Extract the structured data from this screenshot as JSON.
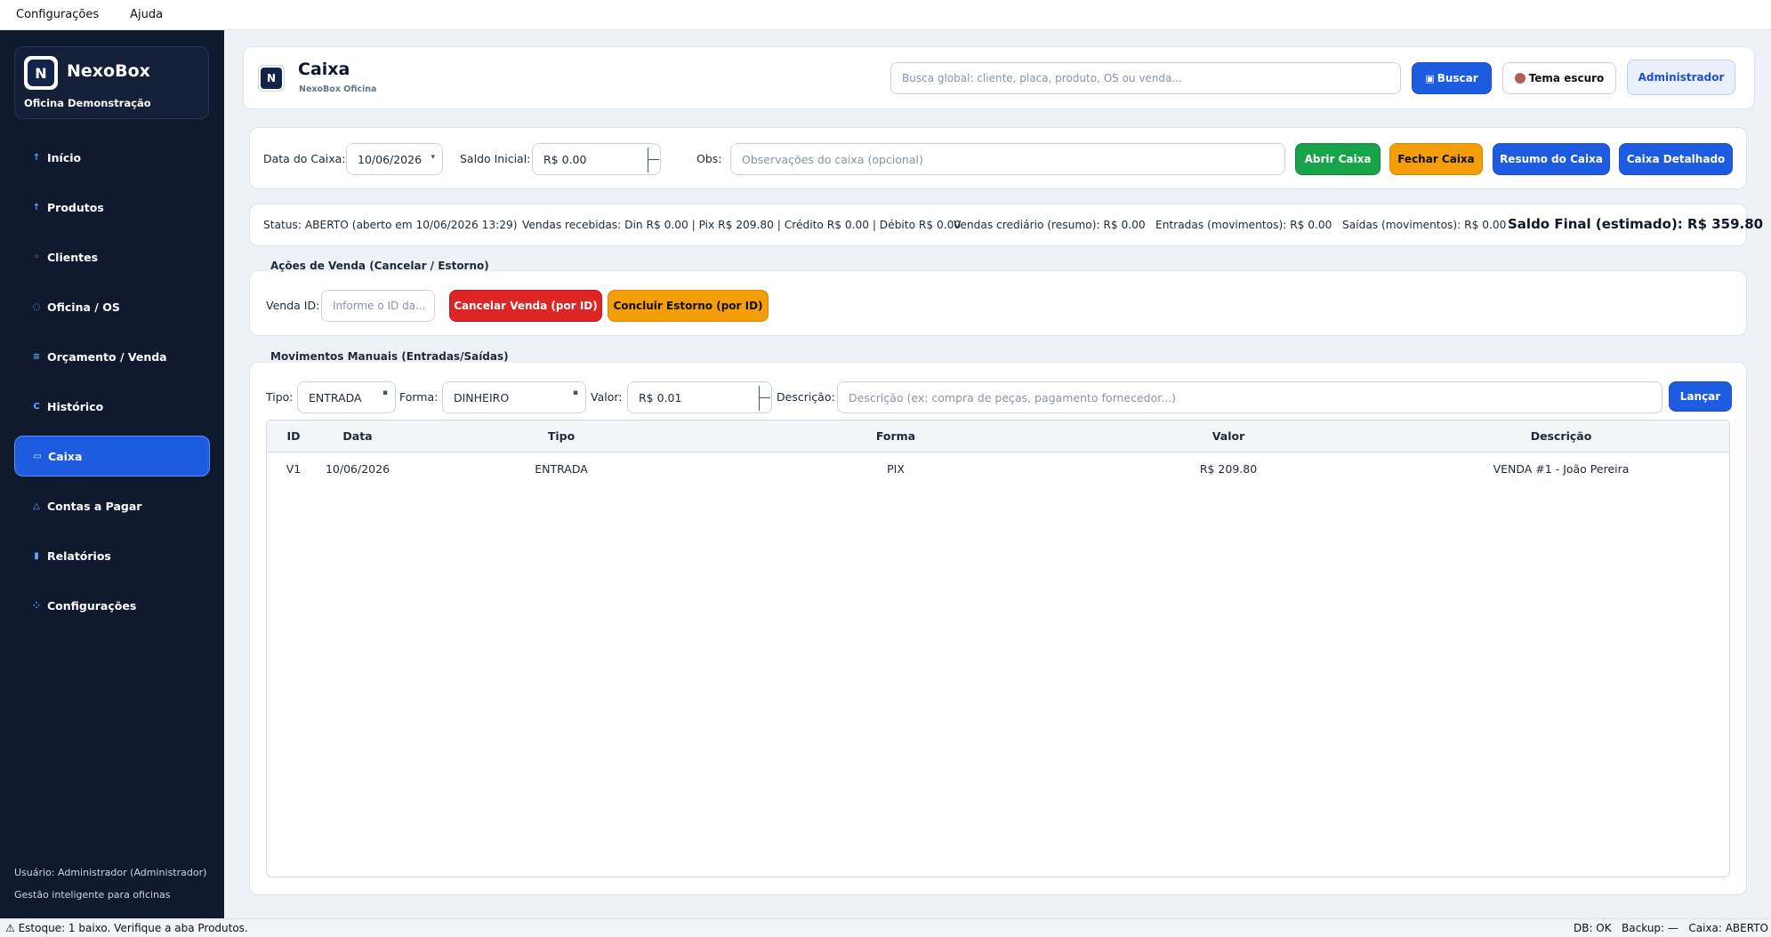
{
  "menubar": {
    "settings": "Configurações",
    "help": "Ajuda"
  },
  "brand": {
    "logo": "N",
    "name": "NexoBox",
    "subtitle": "Oficina Demonstração"
  },
  "sidebar": {
    "items": [
      {
        "label": "Início",
        "icon": "home-icon",
        "glyph": "↑"
      },
      {
        "label": "Produtos",
        "icon": "box-icon",
        "glyph": "↑"
      },
      {
        "label": "Clientes",
        "icon": "user-icon",
        "glyph": "◦"
      },
      {
        "label": "Oficina / OS",
        "icon": "wrench-icon",
        "glyph": "◌"
      },
      {
        "label": "Orçamento / Venda",
        "icon": "list-icon",
        "glyph": "≡"
      },
      {
        "label": "Histórico",
        "icon": "history-icon",
        "glyph": "C"
      },
      {
        "label": "Caixa",
        "icon": "cash-icon",
        "glyph": "▭"
      },
      {
        "label": "Contas a Pagar",
        "icon": "warning-icon",
        "glyph": "△"
      },
      {
        "label": "Relatórios",
        "icon": "chart-icon",
        "glyph": "▮"
      },
      {
        "label": "Configurações",
        "icon": "gear-icon",
        "glyph": "⁘"
      }
    ],
    "user": "Usuário: Administrador (Administrador)",
    "tagline": "Gestão inteligente para oficinas"
  },
  "header": {
    "logo": "N",
    "title": "Caixa",
    "subtitle": "NexoBox Oficina",
    "search_placeholder": "Busca global: cliente, placa, produto, OS ou venda...",
    "search_button": "Buscar",
    "theme_button": "Tema escuro",
    "admin_button": "Administrador"
  },
  "caixa": {
    "date_label": "Data do Caixa:",
    "date_value": "10/06/2026",
    "balance_label": "Saldo Inicial:",
    "balance_value": "R$ 0.00",
    "obs_label": "Obs:",
    "obs_placeholder": "Observações do caixa (opcional)",
    "open_button": "Abrir Caixa",
    "close_button": "Fechar Caixa",
    "summary_button": "Resumo do Caixa",
    "detail_button": "Caixa Detalhado"
  },
  "status": {
    "state": "Status: ABERTO (aberto em 10/06/2026 13:29)",
    "sales": "Vendas recebidas: Din R$ 0.00 | Pix R$ 209.80 | Crédito R$ 0.00 | Débito R$ 0.00",
    "credit": "Vendas crediário (resumo): R$ 0.00",
    "entries": "Entradas (movimentos): R$ 0.00",
    "exits": "Saídas (movimentos): R$ 0.00",
    "final": "Saldo Final (estimado): R$ 359.80"
  },
  "sale_actions": {
    "title": "Ações de Venda (Cancelar / Estorno)",
    "id_label": "Venda ID:",
    "id_placeholder": "Informe o ID da...",
    "cancel_button": "Cancelar Venda (por ID)",
    "refund_button": "Concluir Estorno (por ID)"
  },
  "movements": {
    "title": "Movimentos Manuais (Entradas/Saídas)",
    "type_label": "Tipo:",
    "type_value": "ENTRADA",
    "form_label": "Forma:",
    "form_value": "DINHEIRO",
    "value_label": "Valor:",
    "value_value": "R$ 0.01",
    "desc_label": "Descrição:",
    "desc_placeholder": "Descrição (ex: compra de peças, pagamento fornecedor...)",
    "launch_button": "Lançar",
    "columns": [
      "ID",
      "Data",
      "Tipo",
      "Forma",
      "Valor",
      "Descrição"
    ],
    "rows": [
      [
        "V1",
        "10/06/2026",
        "ENTRADA",
        "PIX",
        "R$ 209.80",
        "VENDA #1 - João Pereira"
      ]
    ]
  },
  "statusbar": {
    "left": "⚠ Estoque: 1 baixo. Verifique a aba Produtos.",
    "right": "DB: OK   Backup: —   Caixa: ABERTO"
  },
  "colors": {
    "accent": "#1d5be0",
    "sidebar": "#0f1a2e",
    "green": "#16a34a",
    "orange": "#f59e0b",
    "red": "#dc2626"
  }
}
